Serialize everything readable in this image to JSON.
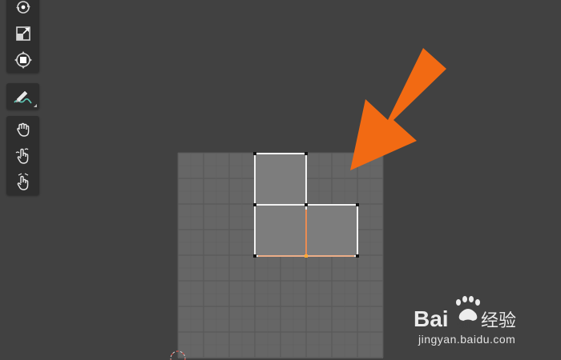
{
  "toolbar": {
    "group_top": [
      {
        "name": "rotate-tool",
        "icon": "rotate-icon"
      },
      {
        "name": "scale-tool",
        "icon": "scale-icon"
      },
      {
        "name": "transform-tool",
        "icon": "transform-icon"
      }
    ],
    "group_mid": [
      {
        "name": "annotate-tool",
        "icon": "annotate-pen-icon"
      }
    ],
    "group_bottom": [
      {
        "name": "grab-tool",
        "icon": "grab-hand-icon"
      },
      {
        "name": "relax-tool",
        "icon": "relax-hand-icon"
      },
      {
        "name": "pinch-tool",
        "icon": "pinch-hand-icon"
      }
    ]
  },
  "uv_editor": {
    "grid_divisions": 8,
    "selected_faces": [
      {
        "col": 3,
        "row": 0
      },
      {
        "col": 3,
        "row": 2
      },
      {
        "col": 5,
        "row": 2
      }
    ]
  },
  "annotation": {
    "arrow_color": "#f26a13"
  },
  "watermark": {
    "logo": "baidu-jingyan-logo",
    "text": "jingyan.baidu.com"
  },
  "colors": {
    "background": "#414141",
    "grid_fill": "#666666",
    "face_fill": "#7a7a7a",
    "selected_edge": "#ff8a1f",
    "vertex_selected": "#ffaa33"
  }
}
